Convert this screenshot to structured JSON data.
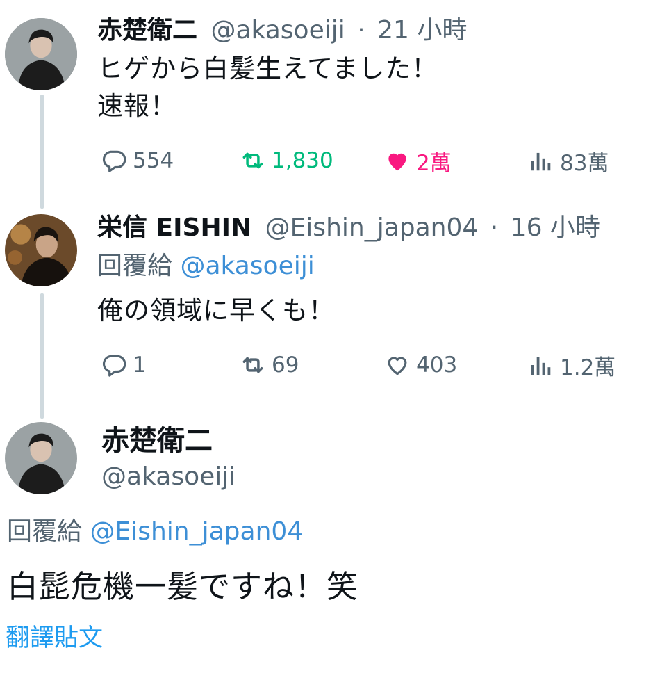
{
  "tweet1": {
    "name": "赤楚衛二",
    "handle": "@akasoeiji",
    "separator": "·",
    "time": "21 小時",
    "text_line1": "ヒゲから白髪生えてました！",
    "text_line2": "速報！",
    "actions": {
      "replies": "554",
      "retweets": "1,830",
      "likes": "2萬",
      "views": "83萬"
    },
    "retweeted": true,
    "liked": true
  },
  "tweet2": {
    "name": "栄信 EISHIN",
    "handle": "@Eishin_japan04",
    "separator": "·",
    "time": "16 小時",
    "reply_prefix": "回覆給",
    "reply_to": "@akasoeiji",
    "text": "俺の領域に早くも！",
    "actions": {
      "replies": "1",
      "retweets": "69",
      "likes": "403",
      "views": "1.2萬"
    },
    "retweeted": false,
    "liked": false
  },
  "main_tweet": {
    "name": "赤楚衛二",
    "handle": "@akasoeiji",
    "reply_prefix": "回覆給",
    "reply_to": "@Eishin_japan04",
    "text": "白髭危機一髪ですね！笑",
    "translate_label": "翻譯貼文"
  },
  "colors": {
    "text": "#0f1419",
    "secondary": "#536471",
    "link": "#1d9bf0",
    "retweet_active": "#00ba7c",
    "like_active": "#f91880",
    "thread_line": "#cfd9de"
  },
  "icons": [
    "reply-icon",
    "retweet-icon",
    "like-icon",
    "views-icon"
  ]
}
